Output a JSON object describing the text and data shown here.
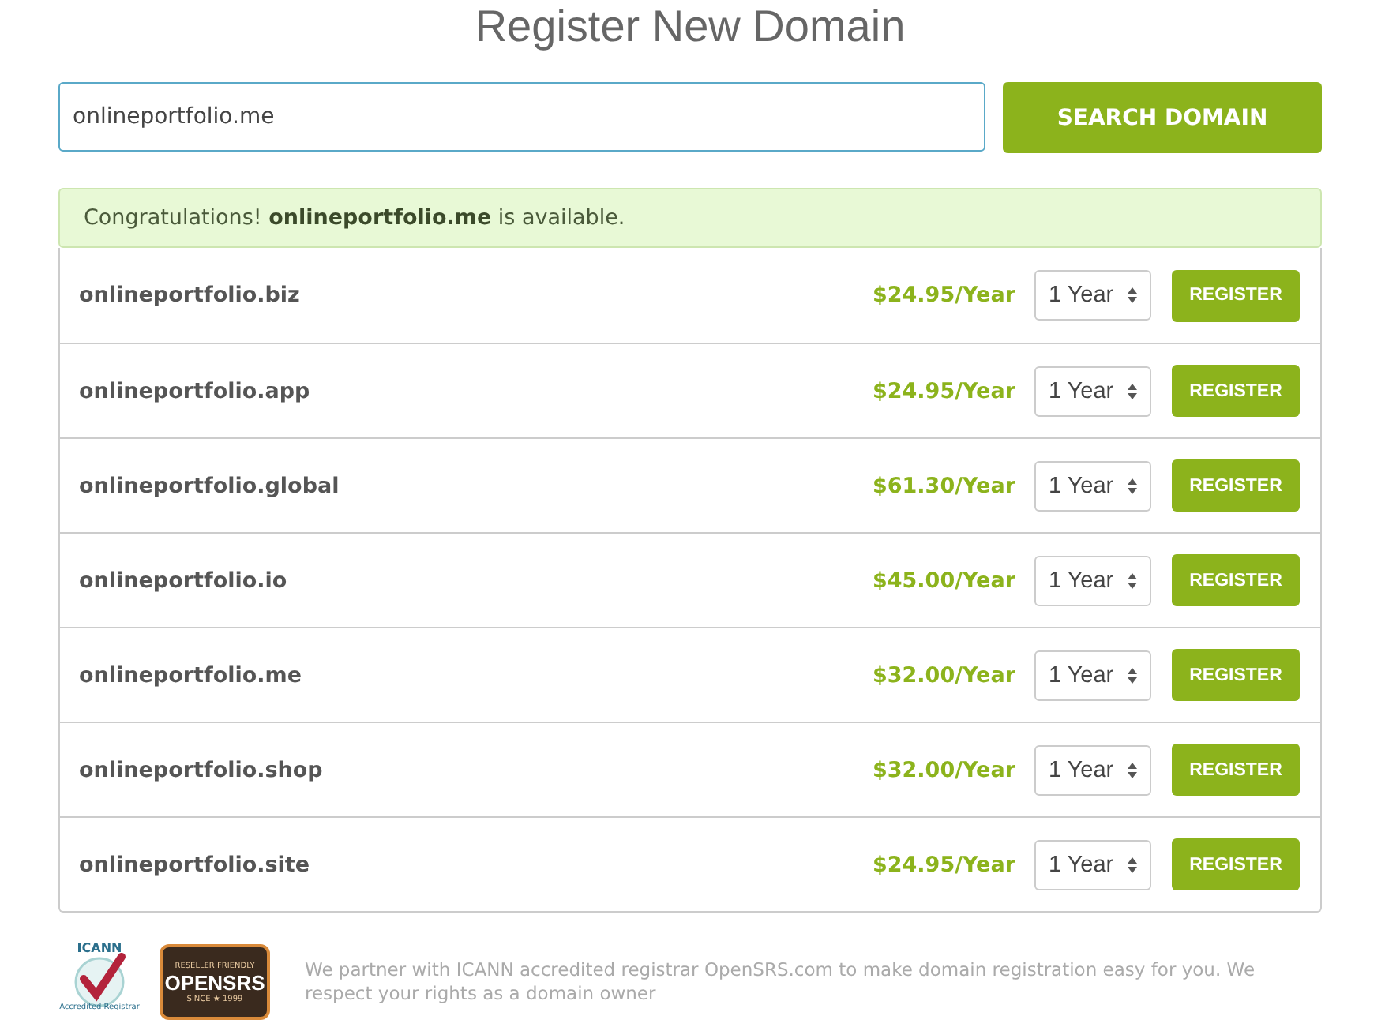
{
  "title": "Register New Domain",
  "search": {
    "value": "onlineportfolio.me",
    "button": "SEARCH DOMAIN"
  },
  "alert": {
    "text": "Congratulations! **onlineportfolio.me** is available."
  },
  "results": [
    {
      "domain": "onlineportfolio.biz",
      "price": "$24.95/Year",
      "term": "1 Year",
      "button": "REGISTER"
    },
    {
      "domain": "onlineportfolio.app",
      "price": "$24.95/Year",
      "term": "1 Year",
      "button": "REGISTER"
    },
    {
      "domain": "onlineportfolio.global",
      "price": "$61.30/Year",
      "term": "1 Year",
      "button": "REGISTER"
    },
    {
      "domain": "onlineportfolio.io",
      "price": "$45.00/Year",
      "term": "1 Year",
      "button": "REGISTER"
    },
    {
      "domain": "onlineportfolio.me",
      "price": "$32.00/Year",
      "term": "1 Year",
      "button": "REGISTER"
    },
    {
      "domain": "onlineportfolio.shop",
      "price": "$32.00/Year",
      "term": "1 Year",
      "button": "REGISTER"
    },
    {
      "domain": "onlineportfolio.site",
      "price": "$24.95/Year",
      "term": "1 Year",
      "button": "REGISTER"
    }
  ],
  "footer": {
    "icann_logo": {
      "name": "ICANN",
      "caption": "Accredited Registrar"
    },
    "opensrs_logo": {
      "top": "RESELLER FRIENDLY",
      "name": "OPENSRS",
      "bottom": "SINCE ★ 1999"
    },
    "text": "We partner with ICANN accredited registrar OpenSRS.com to make domain registration easy for you. We respect your rights as a domain owner"
  }
}
